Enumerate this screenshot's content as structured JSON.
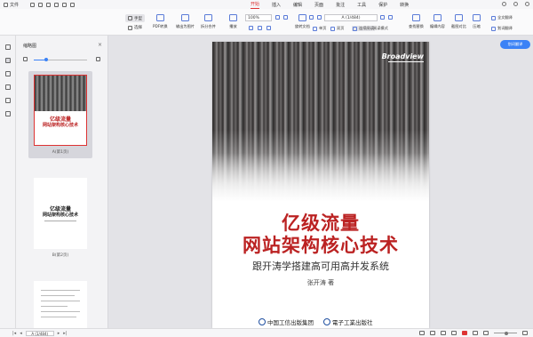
{
  "menubar": {
    "file_label": "文件",
    "menus": [
      "开始",
      "插入",
      "编辑",
      "页面",
      "批注",
      "工具",
      "保护",
      "转换"
    ],
    "active_menu": "开始"
  },
  "toolbar": {
    "hand_label": "手型",
    "select_label": "选择",
    "pdf_convert_label": "PDF转换",
    "export_image_label": "输出为图片",
    "split_merge_label": "拆分合并",
    "play_label": "播放",
    "zoom_value": "100%",
    "rotate_label": "旋转文档",
    "single_page_label": "单页",
    "double_page_label": "双页",
    "continuous_label": "连续阅读",
    "read_mode_label": "阅读模式",
    "page_value": "A (1/484)",
    "find_replace_label": "查找替换",
    "edit_content_label": "编辑内容",
    "screenshot_compare_label": "截图对比",
    "compress_label": "压缩",
    "full_translate_label": "全文翻译",
    "word_translate_label": "划词翻译",
    "translate_button_label": "划词翻译"
  },
  "thumbnail_panel": {
    "title": "缩略图",
    "thumbnails": [
      {
        "caption": "A(第1页)",
        "title1": "亿级流量",
        "title2": "网站架构核心技术"
      },
      {
        "caption": "B(第2页)",
        "title1": "亿级流量",
        "title2": "网站架构核心技术"
      }
    ]
  },
  "cover": {
    "publisher_logo": "Broadview",
    "title_line1": "亿级流量",
    "title_line2": "网站架构核心技术",
    "subtitle": "跟开涛学搭建高可用高并发系统",
    "author": "张开涛  著",
    "publisher_left": "中国工信出版集团",
    "publisher_right": "電子工業出版社"
  },
  "status": {
    "page_value": "A (1/484)"
  },
  "colors": {
    "accent": "#d33333",
    "brand_blue": "#3b82f6",
    "cover_title": "#b22222"
  }
}
